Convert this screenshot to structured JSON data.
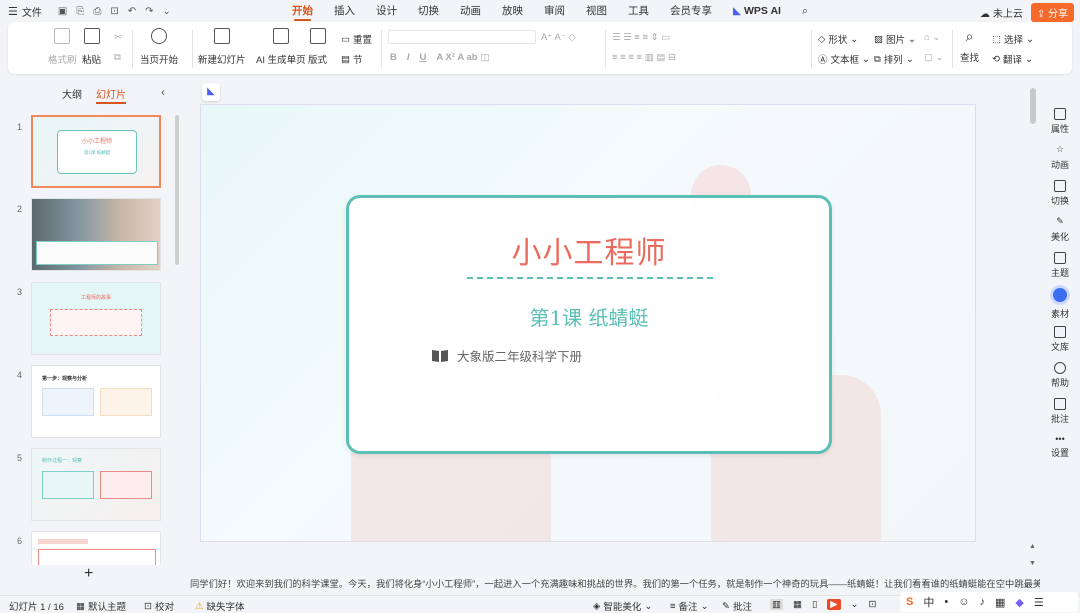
{
  "app": {
    "file_menu": "文件",
    "share": "分享",
    "cloud": "未上云"
  },
  "tabs": [
    "开始",
    "插入",
    "设计",
    "切换",
    "动画",
    "放映",
    "审阅",
    "视图",
    "工具",
    "会员专享",
    "WPS AI"
  ],
  "ribbon": {
    "format_painter": "格式刷",
    "paste": "粘贴",
    "from_current": "当页开始",
    "new_slide": "新建幻灯片",
    "ai_slide": "AI 生成单页",
    "layout": "版式",
    "reset": "重置",
    "section": "节",
    "shape": "形状",
    "picture": "图片",
    "textbox": "文本框",
    "arrange": "排列",
    "find": "查找",
    "select": "选择",
    "translate": "翻译"
  },
  "panel": {
    "outline_tab": "大纲",
    "slides_tab": "幻灯片",
    "add": "+"
  },
  "thumbs": [
    {
      "num": "1",
      "title": "小小工程师",
      "sub": "第1课 纸蜻蜓"
    },
    {
      "num": "2"
    },
    {
      "num": "3",
      "title": "工程师的故事"
    },
    {
      "num": "4",
      "title": "第一步：观察与分析"
    },
    {
      "num": "5",
      "title": "制作过程一：观察"
    },
    {
      "num": "6"
    }
  ],
  "slide": {
    "title": "小小工程师",
    "subtitle": "第1课 纸蜻蜓",
    "book": "大象版二年级科学下册"
  },
  "sidebar": [
    "属性",
    "动画",
    "切换",
    "美化",
    "主题",
    "素材",
    "文库",
    "帮助",
    "批注",
    "设置"
  ],
  "notes": "同学们好！欢迎来到我们的科学课堂。今天，我们将化身“小小工程师”，一起进入一个充满趣味和挑战的世界。我们的第一个任务，就是制作一个神奇的玩具——纸蜻蜓！让我们看看谁的纸蜻蜓能在空中跳最美的舞蹈。",
  "status": {
    "slide_count": "幻灯片 1 / 16",
    "theme": "默认主题",
    "proof": "校对",
    "missing_font": "缺失字体",
    "beautify": "智能美化",
    "notes": "备注",
    "comment": "批注"
  },
  "colors": {
    "accent": "#d8541d",
    "title": "#ec6b5e",
    "teal": "#5bbfb5"
  }
}
